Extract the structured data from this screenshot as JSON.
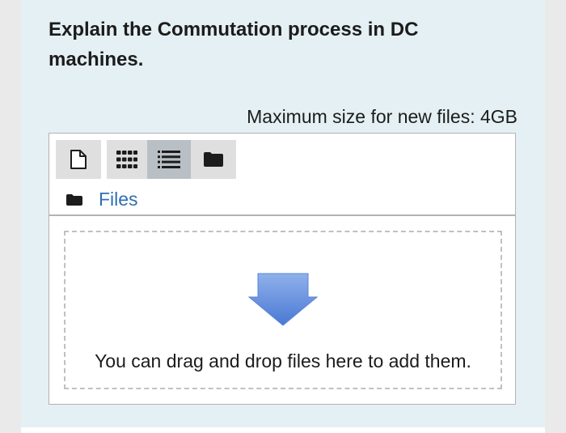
{
  "question": {
    "text": "Explain the Commutation process in DC machines."
  },
  "filepicker": {
    "max_size_text": "Maximum size for new files: 4GB",
    "toolbar": {
      "add_file_icon": "file-add-icon",
      "view_icons_icon": "grid-view-icon",
      "view_details_icon": "list-view-icon",
      "view_tree_icon": "folder-tree-icon",
      "active_view": "list"
    },
    "path": {
      "folder_icon": "folder-icon",
      "label": "Files"
    },
    "dropzone": {
      "icon": "download-arrow-icon",
      "message": "You can drag and drop files here to add them."
    }
  },
  "colors": {
    "card_background": "#e4f0f3",
    "link": "#2e6fb2",
    "arrow_light": "#8fb1ea",
    "arrow_dark": "#4a78d4"
  }
}
